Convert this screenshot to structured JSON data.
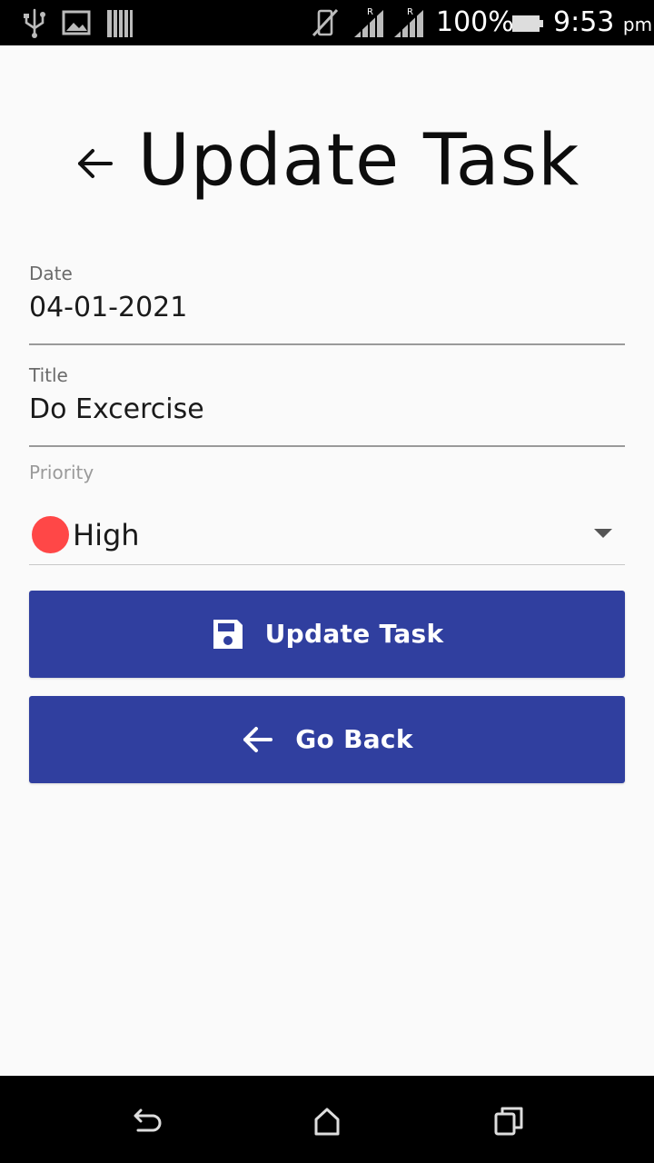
{
  "status_bar": {
    "battery_percent": "100%",
    "time": "9:53",
    "ampm": "pm",
    "icons": [
      "usb-icon",
      "image-icon",
      "storage-icon",
      "mute-icon",
      "signal-r-icon",
      "signal-r-icon",
      "battery-icon"
    ]
  },
  "header": {
    "title": "Update Task",
    "back_icon": "arrow-left-icon"
  },
  "form": {
    "date": {
      "label": "Date",
      "value": "04-01-2021"
    },
    "title": {
      "label": "Title",
      "value": "Do Excercise"
    },
    "priority": {
      "label": "Priority",
      "value": "High",
      "dot_color": "#ff4747"
    }
  },
  "buttons": {
    "update": {
      "label": "Update Task",
      "icon": "save-icon"
    },
    "back": {
      "label": "Go Back",
      "icon": "arrow-left-icon"
    }
  },
  "nav_bar": {
    "icons": [
      "back-icon",
      "home-icon",
      "recents-icon"
    ]
  },
  "colors": {
    "primary": "#303f9f",
    "background": "#fafafa",
    "priority_high": "#ff4747"
  }
}
